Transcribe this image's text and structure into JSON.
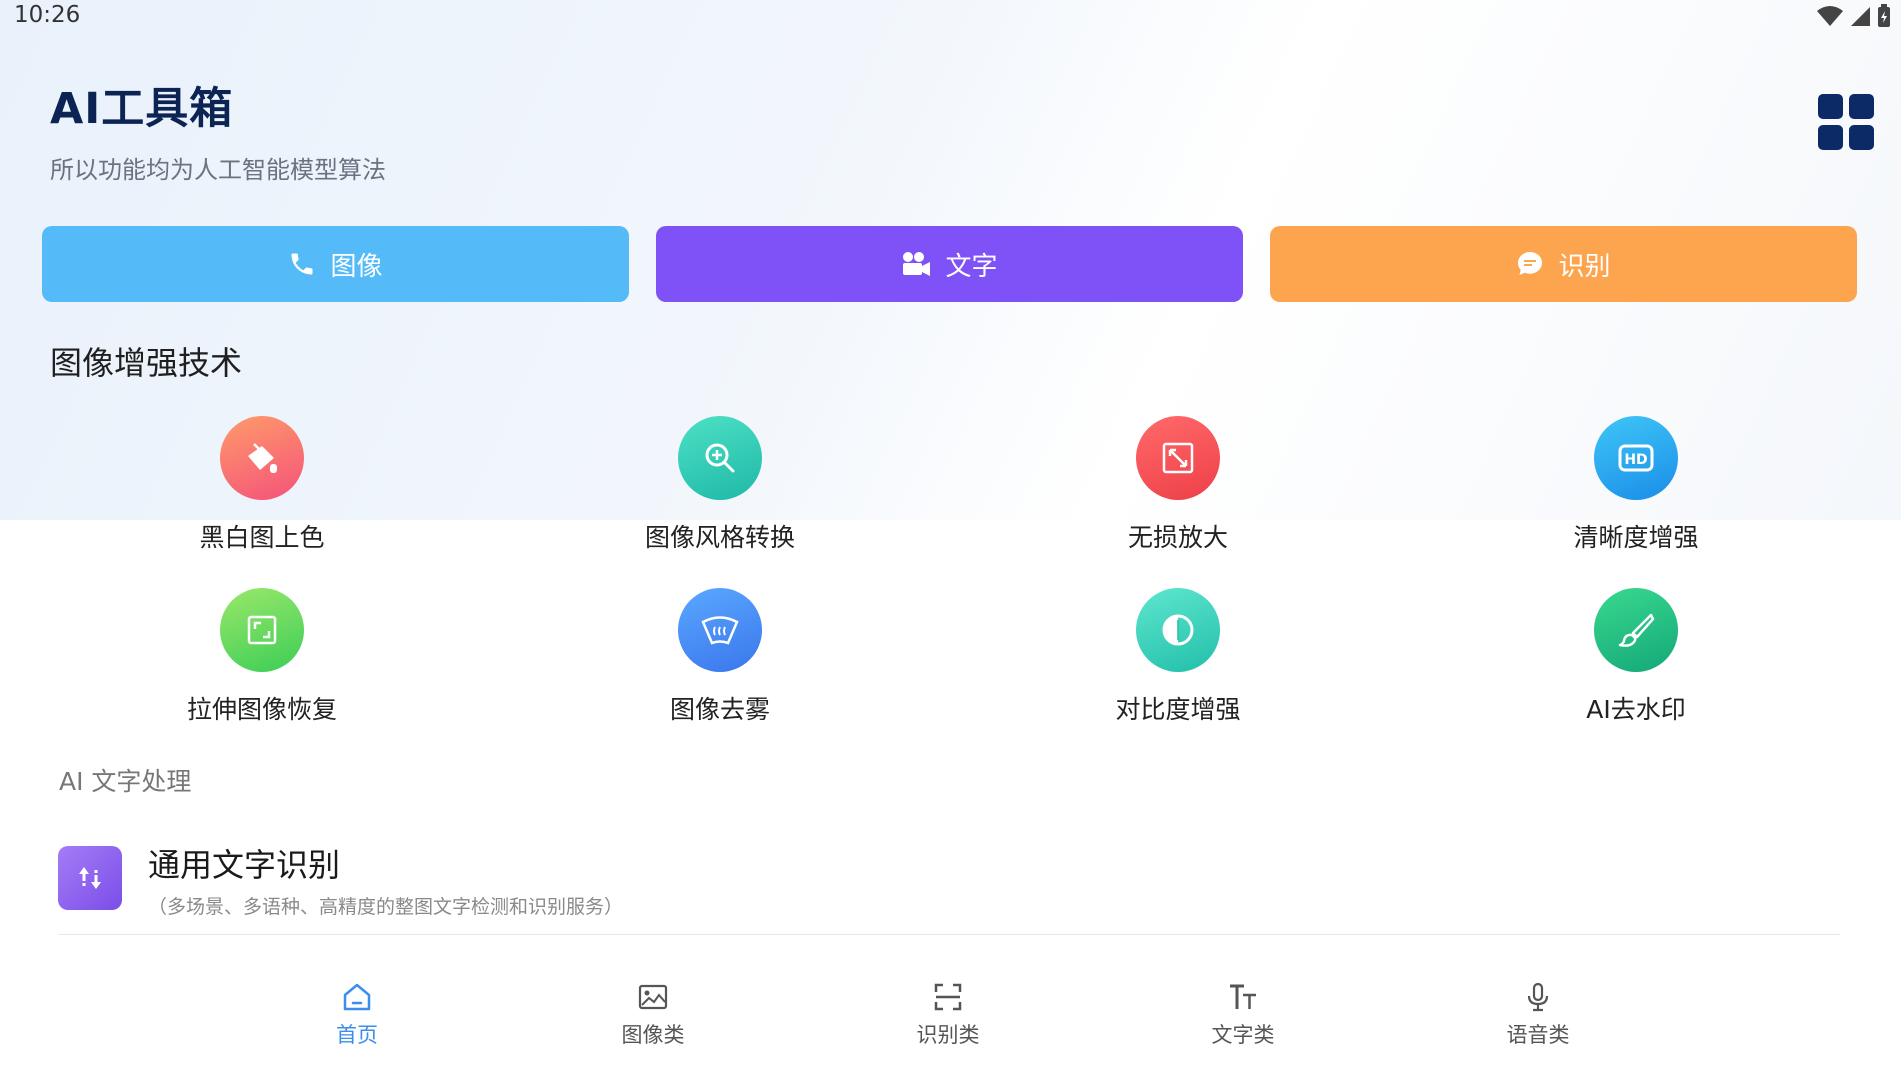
{
  "status_bar": {
    "time": "10:26"
  },
  "header": {
    "title": "AI工具箱",
    "subtitle": "所以功能均为人工智能模型算法"
  },
  "top_buttons": [
    {
      "label": "图像",
      "icon": "phone-icon",
      "color": "#54bbf8"
    },
    {
      "label": "文字",
      "icon": "video-camera-icon",
      "color": "#7f52f7"
    },
    {
      "label": "识别",
      "icon": "chat-bubble-icon",
      "color": "#fca44e"
    }
  ],
  "section_image": {
    "title": "图像增强技术",
    "features": [
      {
        "label": "黑白图上色",
        "icon": "paint-bucket-icon",
        "color_from": "#ff9b6a",
        "color_to": "#f4527a"
      },
      {
        "label": "图像风格转换",
        "icon": "magnifier-plus-icon",
        "color_from": "#4de0c5",
        "color_to": "#1fb9a7"
      },
      {
        "label": "无损放大",
        "icon": "expand-icon",
        "color_from": "#ff6a6a",
        "color_to": "#ee3f48"
      },
      {
        "label": "清晰度增强",
        "icon": "hd-icon",
        "color_from": "#3fc6f7",
        "color_to": "#1a8de8"
      },
      {
        "label": "拉伸图像恢复",
        "icon": "crop-icon",
        "color_from": "#9ae86a",
        "color_to": "#3ccd56"
      },
      {
        "label": "图像去雾",
        "icon": "defog-icon",
        "color_from": "#5aa8ff",
        "color_to": "#3a76ec"
      },
      {
        "label": "对比度增强",
        "icon": "contrast-icon",
        "color_from": "#5fe6cf",
        "color_to": "#22bfa9"
      },
      {
        "label": "AI去水印",
        "icon": "brush-icon",
        "color_from": "#39d88f",
        "color_to": "#14a878"
      }
    ]
  },
  "section_text": {
    "title": "AI 文字处理",
    "item": {
      "title": "通用文字识别",
      "description": "（多场景、多语种、高精度的整图文字检测和识别服务）",
      "icon": "sort-arrows-icon"
    }
  },
  "bottom_nav": [
    {
      "label": "首页",
      "icon": "home-icon",
      "active": true
    },
    {
      "label": "图像类",
      "icon": "image-icon",
      "active": false
    },
    {
      "label": "识别类",
      "icon": "scan-icon",
      "active": false
    },
    {
      "label": "文字类",
      "icon": "text-size-icon",
      "active": false
    },
    {
      "label": "语音类",
      "icon": "microphone-icon",
      "active": false
    }
  ],
  "colors": {
    "title": "#0c2453",
    "accent": "#3b8eed"
  }
}
